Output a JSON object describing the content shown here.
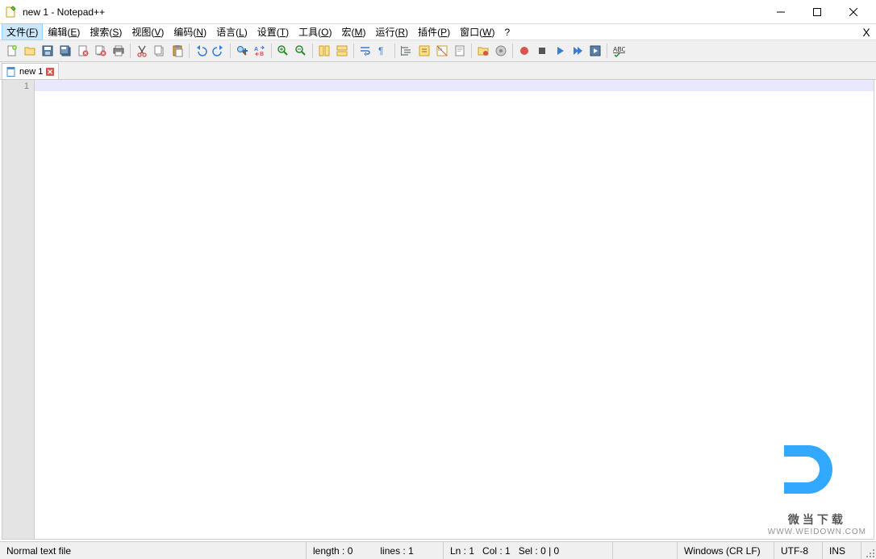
{
  "window": {
    "title": "new 1 - Notepad++"
  },
  "menus": [
    {
      "label": "文件(F)",
      "key": "F",
      "active": true
    },
    {
      "label": "编辑(E)",
      "key": "E"
    },
    {
      "label": "搜索(S)",
      "key": "S"
    },
    {
      "label": "视图(V)",
      "key": "V"
    },
    {
      "label": "编码(N)",
      "key": "N"
    },
    {
      "label": "语言(L)",
      "key": "L"
    },
    {
      "label": "设置(T)",
      "key": "T"
    },
    {
      "label": "工具(O)",
      "key": "O"
    },
    {
      "label": "宏(M)",
      "key": "M"
    },
    {
      "label": "运行(R)",
      "key": "R"
    },
    {
      "label": "插件(P)",
      "key": "P"
    },
    {
      "label": "窗口(W)",
      "key": "W"
    },
    {
      "label": "?",
      "key": "?"
    }
  ],
  "tabs": [
    {
      "label": "new 1"
    }
  ],
  "editor": {
    "line_numbers": [
      "1"
    ]
  },
  "status": {
    "file_type": "Normal text file",
    "length": "length : 0",
    "lines": "lines : 1",
    "ln": "Ln : 1",
    "col": "Col : 1",
    "sel": "Sel : 0 | 0",
    "eol": "Windows (CR LF)",
    "encoding": "UTF-8",
    "ins": "INS"
  },
  "toolbar_icons": [
    "new",
    "open",
    "save",
    "save-all",
    "close",
    "close-all",
    "print",
    "sep",
    "cut",
    "copy",
    "paste",
    "sep",
    "undo",
    "redo",
    "sep",
    "find",
    "replace",
    "sep",
    "zoom-in",
    "zoom-out",
    "sep",
    "sync-v",
    "sync-h",
    "sep",
    "word-wrap",
    "show-all",
    "sep",
    "indent-guide",
    "fold",
    "language",
    "doc-map",
    "sep",
    "folder",
    "func-list",
    "sep",
    "record",
    "stop",
    "play",
    "play-multi",
    "save-macro",
    "sep",
    "spellcheck"
  ],
  "watermark": {
    "logo": "D",
    "line1": "微当下载",
    "line2": "WWW.WEIDOWN.COM"
  }
}
